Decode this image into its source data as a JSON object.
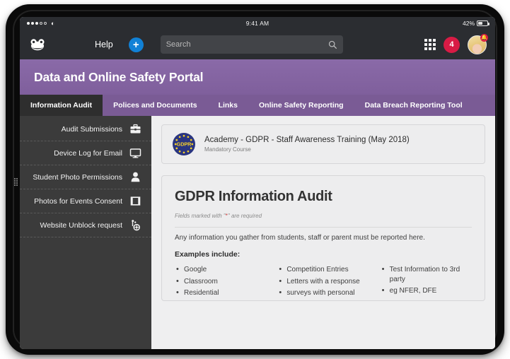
{
  "status_bar": {
    "signal_filled": 3,
    "signal_empty": 2,
    "wifi_icon": "wifi-icon",
    "time": "9:41 AM",
    "battery_percent": "42%"
  },
  "top_nav": {
    "logo_icon": "frog-logo-icon",
    "help_label": "Help",
    "add_label": "+",
    "search_placeholder": "Search",
    "search_value": "",
    "search_icon": "search-icon",
    "apps_grid_icon": "apps-grid-icon",
    "notification_count": "4",
    "avatar_badge_icon": "bell-icon",
    "avatar_icon": "user-avatar"
  },
  "banner": {
    "title": "Data and Online Safety Portal",
    "color": "#7f5f9c"
  },
  "tabs": [
    {
      "label": "Information Audit",
      "active": true
    },
    {
      "label": "Polices and Documents",
      "active": false
    },
    {
      "label": "Links",
      "active": false
    },
    {
      "label": "Online Safety Reporting",
      "active": false
    },
    {
      "label": "Data Breach Reporting Tool",
      "active": false
    }
  ],
  "sidebar": {
    "items": [
      {
        "label": "Audit Submissions",
        "icon": "briefcase-icon"
      },
      {
        "label": "Device Log for Email",
        "icon": "monitor-icon"
      },
      {
        "label": "Student Photo Permissions",
        "icon": "person-icon"
      },
      {
        "label": "Photos for Events Consent",
        "icon": "photo-frame-icon"
      },
      {
        "label": "Website Unblock request",
        "icon": "globe-cog-icon"
      }
    ]
  },
  "course_card": {
    "badge_icon": "gdpr-eu-badge-icon",
    "badge_text": "GDPR",
    "title": "Academy - GDPR - Staff Awareness Training (May 2018)",
    "subtitle": "Mandatory Course"
  },
  "audit_card": {
    "heading": "GDPR Information Audit",
    "required_note_before": "Fields marked with \"",
    "required_star": "*",
    "required_note_after": "\" are required",
    "intro": "Any information you gather from students, staff or parent must be reported here.",
    "examples_label": "Examples include:",
    "examples_columns": [
      [
        "Google",
        "Classroom",
        "Residential"
      ],
      [
        "Competition Entries",
        "Letters with a response",
        "surveys with personal"
      ],
      [
        "Test Information to 3rd party",
        "eg NFER, DFE"
      ]
    ]
  }
}
